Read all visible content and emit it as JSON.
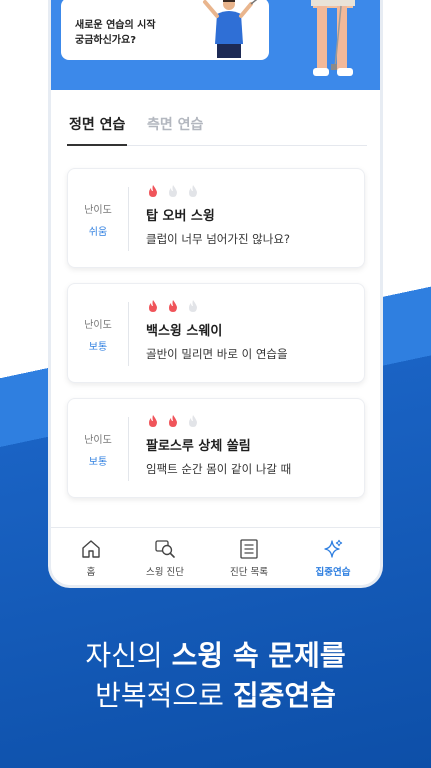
{
  "hero": {
    "card_text_1": "새로운 연습의 시작",
    "card_text_2": "궁금하신가요?"
  },
  "tabs": [
    {
      "label": "정면 연습",
      "active": true
    },
    {
      "label": "측면 연습",
      "active": false
    }
  ],
  "cards": [
    {
      "difficulty_label": "난이도",
      "difficulty": "쉬움",
      "level": 1,
      "max_level": 3,
      "title": "탑 오버 스윙",
      "description": "클럽이 너무 넘어가진 않나요?"
    },
    {
      "difficulty_label": "난이도",
      "difficulty": "보통",
      "level": 2,
      "max_level": 3,
      "title": "백스윙 스웨이",
      "description": "골반이 밀리면 바로 이 연습을"
    },
    {
      "difficulty_label": "난이도",
      "difficulty": "보통",
      "level": 2,
      "max_level": 3,
      "title": "팔로스루 상체 쏠림",
      "description": "임팩트 순간 몸이 같이 나갈 때"
    }
  ],
  "nav": [
    {
      "label": "홈",
      "icon": "home-icon",
      "active": false
    },
    {
      "label": "스윙 진단",
      "icon": "swing-search-icon",
      "active": false
    },
    {
      "label": "진단 목록",
      "icon": "document-list-icon",
      "active": false
    },
    {
      "label": "집중연습",
      "icon": "sparkle-icon",
      "active": true
    }
  ],
  "slogan": {
    "line1_a": "자신의 ",
    "line1_b": "스윙 속 문제를",
    "line2_a": "반복적으로 ",
    "line2_b": "집중연습"
  },
  "colors": {
    "accent": "#2f7fe0",
    "hero": "#3c89ea",
    "flame_on": "#f0545a",
    "flame_off": "#e2e4e8",
    "bottom_bg": "#0d4fa8"
  }
}
